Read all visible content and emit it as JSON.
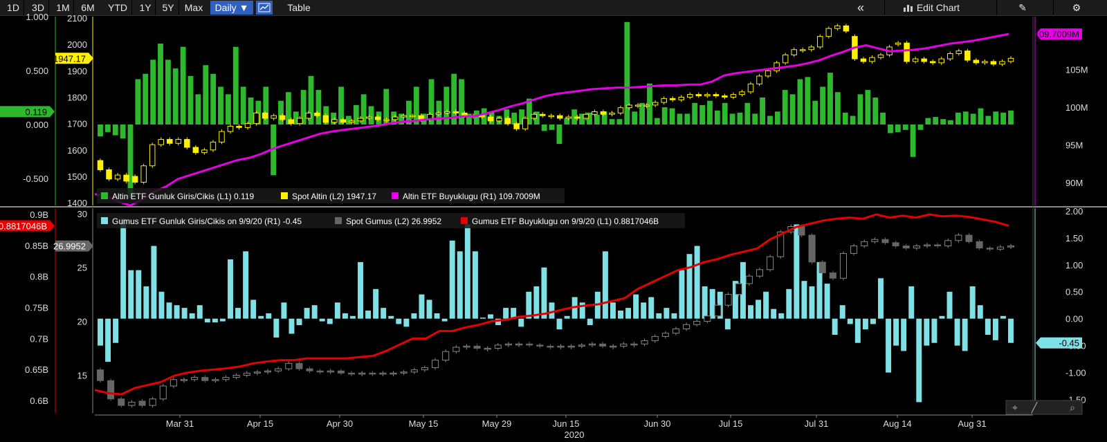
{
  "toolbar": {
    "ranges": [
      "1D",
      "3D",
      "1M",
      "6M",
      "YTD",
      "1Y",
      "5Y",
      "Max"
    ],
    "interval": "Daily",
    "table_label": "Table",
    "collapse_label": "«",
    "edit_chart_label": "Edit Chart",
    "icons": [
      "line-chart-icon",
      "pencil-icon",
      "gear-icon",
      "crosshair-icon",
      "draw-icon",
      "zoom-icon"
    ]
  },
  "colors": {
    "gold_flows": "#2db82d",
    "gold_price": "#ffef00",
    "gold_holdings": "#e600e6",
    "silver_flows": "#7fe0e6",
    "silver_price": "#666666",
    "silver_holdings": "#e60000"
  },
  "chart_data": [
    {
      "type": "bar",
      "panel": "top",
      "legend": [
        {
          "label": "Altin ETF Gunluk Giris/Cikis (L1) 0.119",
          "color": "#2db82d"
        },
        {
          "label": "Spot Altin (L2) 1947.17",
          "color": "#ffef00"
        },
        {
          "label": "Altin ETF Buyuklugu (R1) 109.7009M",
          "color": "#e600e6"
        }
      ],
      "axes": {
        "L1": {
          "ticks": [
            "1.000",
            "0.500",
            "0.000",
            "-0.500"
          ],
          "tick_values": [
            1.0,
            0.5,
            0.0,
            -0.5
          ],
          "range": [
            -0.75,
            1.0
          ],
          "marker": "0.119"
        },
        "L2": {
          "ticks": [
            "2100",
            "2000",
            "1900",
            "1800",
            "1700",
            "1600",
            "1500",
            "1400"
          ],
          "tick_values": [
            2100,
            2000,
            1900,
            1800,
            1700,
            1600,
            1500,
            1400
          ],
          "range": [
            1390,
            2105
          ],
          "marker": "1947.17"
        },
        "R1": {
          "ticks": [
            "105M",
            "100M",
            "95M",
            "90M"
          ],
          "tick_values": [
            105,
            100,
            95,
            90
          ],
          "range": [
            87,
            112
          ],
          "marker": "109.7009M"
        }
      },
      "series": [
        {
          "name": "Altin ETF Gunluk Giris/Cikis",
          "axis": "L1",
          "kind": "bar",
          "values": [
            -0.11,
            -0.07,
            -0.1,
            -0.13,
            -0.68,
            0.42,
            0.47,
            0.6,
            0.75,
            0.6,
            0.52,
            0.72,
            0.45,
            0.28,
            0.55,
            0.47,
            0.35,
            0.28,
            0.72,
            0.35,
            0.25,
            0.22,
            0.35,
            -0.47,
            0.22,
            0.3,
            0.12,
            0.32,
            0.45,
            0.32,
            0.17,
            0.11,
            0.35,
            0.08,
            0.18,
            0.28,
            0.17,
            0.12,
            0.33,
            0.12,
            0.1,
            0.22,
            0.35,
            0.1,
            0.42,
            0.22,
            0.35,
            0.47,
            0.42,
            0.1,
            0.13,
            0.15,
            0.12,
            0.08,
            0.14,
            0.11,
            0.14,
            0.24,
            0.12,
            -0.06,
            -0.05,
            -0.18,
            0.06,
            0.14,
            0.1,
            0.11,
            0.09,
            0.12,
            0.05,
            0.05,
            0.95,
            0.12,
            0.2,
            0.38,
            0.06,
            0.16,
            0.15,
            0.1,
            0.1,
            0.2,
            0.18,
            0.22,
            0.13,
            0.2,
            0.1,
            0.11,
            0.2,
            0.1,
            0.25,
            0.08,
            0.12,
            0.32,
            0.28,
            0.42,
            0.44,
            0.22,
            0.35,
            0.48,
            0.3,
            0.11,
            0.08,
            0.28,
            0.32,
            0.25,
            0.11,
            -0.08,
            -0.07,
            -0.05,
            -0.3,
            -0.05,
            0.06,
            0.07,
            0.05,
            0.04,
            0.11,
            0.12,
            0.1,
            0.15,
            0.08,
            0.12,
            0.11,
            0.13
          ]
        },
        {
          "name": "Spot Altin",
          "axis": "L2",
          "kind": "candlestick",
          "close": [
            1525,
            1490,
            1505,
            1482,
            1478,
            1540,
            1620,
            1640,
            1625,
            1640,
            1610,
            1590,
            1600,
            1630,
            1670,
            1690,
            1685,
            1700,
            1740,
            1720,
            1730,
            1715,
            1700,
            1720,
            1740,
            1730,
            1705,
            1715,
            1705,
            1710,
            1720,
            1725,
            1715,
            1715,
            1725,
            1730,
            1730,
            1715,
            1735,
            1740,
            1745,
            1740,
            1730,
            1730,
            1725,
            1710,
            1720,
            1700,
            1680,
            1720,
            1735,
            1730,
            1730,
            1720,
            1725,
            1720,
            1735,
            1745,
            1735,
            1740,
            1760,
            1770,
            1770,
            1770,
            1780,
            1795,
            1790,
            1800,
            1810,
            1805,
            1810,
            1805,
            1800,
            1810,
            1820,
            1850,
            1880,
            1900,
            1930,
            1960,
            1980,
            1980,
            1990,
            2030,
            2060,
            2070,
            2050,
            1945,
            1935,
            1950,
            1960,
            1990,
            2005,
            1935,
            1945,
            1935,
            1930,
            1945,
            1965,
            1975,
            1940,
            1930,
            1935,
            1925,
            1935,
            1947.17
          ],
          "open": [
            1560,
            1525,
            1490,
            1505,
            1500,
            1478,
            1540,
            1620,
            1640,
            1625,
            1640,
            1610,
            1590,
            1600,
            1630,
            1670,
            1690,
            1685,
            1700,
            1740,
            1720,
            1730,
            1715,
            1700,
            1720,
            1740,
            1730,
            1705,
            1715,
            1705,
            1710,
            1720,
            1725,
            1715,
            1715,
            1725,
            1730,
            1730,
            1715,
            1735,
            1740,
            1745,
            1740,
            1730,
            1730,
            1725,
            1710,
            1720,
            1700,
            1680,
            1720,
            1735,
            1730,
            1730,
            1720,
            1725,
            1720,
            1735,
            1745,
            1735,
            1740,
            1760,
            1770,
            1770,
            1770,
            1780,
            1795,
            1790,
            1800,
            1810,
            1805,
            1810,
            1805,
            1800,
            1810,
            1820,
            1850,
            1880,
            1900,
            1930,
            1960,
            1980,
            1980,
            1990,
            2030,
            2060,
            2070,
            2030,
            1945,
            1935,
            1950,
            1960,
            2000,
            2005,
            1935,
            1945,
            1935,
            1930,
            1945,
            1965,
            1975,
            1940,
            1930,
            1935,
            1925,
            1935
          ]
        },
        {
          "name": "Altin ETF Buyuklugu",
          "axis": "R1",
          "kind": "line",
          "values": [
            88.5,
            88.2,
            87.5,
            87,
            87.8,
            88.8,
            89.5,
            90.5,
            91,
            91.5,
            92,
            92.5,
            93,
            93.3,
            93.8,
            94.5,
            95,
            95.5,
            96,
            96.5,
            96.8,
            97,
            97.2,
            97.4,
            97.6,
            97.9,
            98.1,
            98.2,
            98.4,
            98.5,
            98.6,
            98.8,
            98.8,
            99.2,
            99.6,
            100.1,
            100.5,
            101,
            101.5,
            101.8,
            102,
            102.2,
            102.4,
            102.5,
            102.6,
            102.6,
            102.7,
            102.8,
            102.9,
            102.9,
            103,
            103,
            103.4,
            104.2,
            104.5,
            104.7,
            104.9,
            105.1,
            105.3,
            105.5,
            105.8,
            106.2,
            106.8,
            107.3,
            107.9,
            108.2,
            107.8,
            107.4,
            107.5,
            107.6,
            107.8,
            108.1,
            108.4,
            108.6,
            108.8,
            109.1,
            109.4,
            109.7009
          ]
        }
      ]
    },
    {
      "type": "bar",
      "panel": "bottom",
      "legend": [
        {
          "label": "Gumus ETF Gunluk Giris/Cikis on 9/9/20 (R1) -0.45",
          "color": "#7fe0e6"
        },
        {
          "label": "Spot Gumus (L2) 26.9952",
          "color": "#666666"
        },
        {
          "label": "Gumus ETF Buyuklugu on 9/9/20 (L1) 0.8817046B",
          "color": "#e60000"
        }
      ],
      "axes": {
        "L1": {
          "ticks": [
            "0.9B",
            "0.85B",
            "0.8B",
            "0.75B",
            "0.7B",
            "0.65B",
            "0.6B"
          ],
          "tick_values": [
            0.9,
            0.85,
            0.8,
            0.75,
            0.7,
            0.65,
            0.6
          ],
          "range": [
            0.58,
            0.91
          ],
          "marker": "0.8817046B"
        },
        "L2": {
          "ticks": [
            "30",
            "25",
            "20",
            "15"
          ],
          "tick_values": [
            30,
            25,
            20,
            15
          ],
          "range": [
            11.5,
            30.5
          ],
          "marker": "26.9952"
        },
        "R1": {
          "ticks": [
            "2.00",
            "1.50",
            "1.00",
            "0.50",
            "0.00",
            "-0.50",
            "-1.00",
            "-1.50"
          ],
          "tick_values": [
            2.0,
            1.5,
            1.0,
            0.5,
            0.0,
            -0.5,
            -1.0,
            -1.5
          ],
          "range": [
            -1.75,
            2.05
          ],
          "marker": "-0.45"
        }
      },
      "series": [
        {
          "name": "Gumus ETF Gunluk Giris/Cikis",
          "axis": "R1",
          "kind": "bar",
          "values": [
            -0.5,
            -0.8,
            -0.45,
            1.85,
            0.9,
            0.9,
            0.6,
            1.35,
            0.5,
            0.3,
            0.25,
            0.2,
            0.1,
            0.25,
            -0.07,
            -0.07,
            -0.05,
            1.1,
            0.2,
            1.25,
            0.35,
            0.05,
            0.1,
            -0.35,
            0.3,
            -0.28,
            -0.12,
            0.2,
            0.25,
            -0.05,
            -0.1,
            0.3,
            0.1,
            0.05,
            1.05,
            0.15,
            0.55,
            0.2,
            0.05,
            -0.1,
            -0.15,
            0.1,
            0.45,
            0.35,
            0.1,
            -0.05,
            1.45,
            1.25,
            1.75,
            1.25,
            0.02,
            0.08,
            -0.12,
            0.2,
            0.2,
            -0.15,
            0.5,
            0.6,
            0.95,
            0.3,
            -0.2,
            0.05,
            0.4,
            0.3,
            -0.12,
            0.5,
            1.25,
            0.3,
            0.15,
            0.2,
            0.45,
            0.3,
            0.4,
            0.1,
            0.2,
            0.1,
            0.9,
            1.2,
            1.35,
            0.6,
            0.55,
            0.5,
            -0.2,
            0.7,
            1.05,
            0.25,
            0.35,
            0.5,
            0.18,
            0.1,
            0.55,
            1.75,
            0.7,
            0.6,
            1.05,
            0.65,
            -0.3,
            0.25,
            -0.1,
            -0.45,
            -0.2,
            -0.1,
            0.75,
            -1.0,
            -0.5,
            -0.6,
            0.6,
            -1.55,
            -0.5,
            -0.45,
            0.05,
            0.5,
            -0.5,
            -0.6,
            0.6,
            0.25,
            -0.3,
            -0.4,
            0.05,
            -0.45
          ]
        },
        {
          "name": "Spot Gumus",
          "axis": "L2",
          "kind": "candlestick",
          "close": [
            14.5,
            12.8,
            12.2,
            12.5,
            12.2,
            12.8,
            14,
            14.6,
            14.6,
            14.8,
            14.5,
            14.6,
            14.8,
            15,
            15.2,
            15.3,
            15.4,
            15.6,
            16.1,
            15.6,
            15.4,
            15.3,
            15.4,
            15.2,
            15.1,
            15.2,
            15.1,
            15.2,
            15.2,
            15.3,
            15.5,
            15.7,
            16.4,
            17.2,
            17.6,
            17.7,
            17.5,
            17.5,
            17.8,
            17.9,
            17.9,
            17.8,
            17.7,
            17.6,
            17.7,
            17.7,
            17.8,
            17.9,
            17.7,
            17.7,
            17.9,
            17.9,
            18.2,
            18.6,
            18.9,
            19.3,
            19.7,
            20,
            20.5,
            21.5,
            22.5,
            23.5,
            24.2,
            24.8,
            26,
            28.3,
            28.8,
            28,
            25.5,
            24.5,
            24,
            26.3,
            27,
            27.4,
            27.6,
            27.3,
            27,
            26.8,
            27,
            27.1,
            27,
            27.5,
            28,
            27.4,
            26.8,
            26.7,
            26.9,
            26.9952
          ],
          "open": [
            15.5,
            14.5,
            12.8,
            12.2,
            12.6,
            12.2,
            12.8,
            14,
            14.6,
            14.6,
            14.8,
            14.5,
            14.6,
            14.8,
            15,
            15.2,
            15.3,
            15.4,
            15.6,
            16.1,
            15.6,
            15.4,
            15.3,
            15.4,
            15.2,
            15.1,
            15.2,
            15.1,
            15.2,
            15.2,
            15.3,
            15.5,
            15.7,
            16.4,
            17.2,
            17.6,
            17.7,
            17.5,
            17.5,
            17.8,
            17.9,
            17.9,
            17.8,
            17.7,
            17.6,
            17.7,
            17.7,
            17.8,
            17.9,
            17.7,
            17.7,
            17.9,
            17.9,
            18.2,
            18.6,
            18.9,
            19.3,
            19.7,
            20,
            20.5,
            21.5,
            22.5,
            23.5,
            24.2,
            24.8,
            26,
            28.3,
            28.8,
            28,
            25.5,
            24.5,
            24,
            26.3,
            27,
            27.4,
            27.6,
            27.3,
            27,
            26.8,
            27,
            27.1,
            27,
            27.5,
            28,
            27.4,
            26.8,
            26.7,
            26.9
          ]
        },
        {
          "name": "Gumus ETF Buyuklugu",
          "axis": "L1",
          "kind": "line",
          "values": [
            0.617,
            0.612,
            0.61,
            0.62,
            0.625,
            0.63,
            0.64,
            0.645,
            0.648,
            0.65,
            0.652,
            0.655,
            0.66,
            0.663,
            0.665,
            0.665,
            0.668,
            0.668,
            0.668,
            0.668,
            0.67,
            0.672,
            0.68,
            0.69,
            0.7,
            0.7,
            0.712,
            0.712,
            0.718,
            0.722,
            0.728,
            0.73,
            0.735,
            0.737,
            0.74,
            0.745,
            0.75,
            0.753,
            0.755,
            0.76,
            0.765,
            0.78,
            0.79,
            0.8,
            0.81,
            0.815,
            0.823,
            0.828,
            0.835,
            0.84,
            0.845,
            0.86,
            0.87,
            0.88,
            0.885,
            0.89,
            0.893,
            0.895,
            0.893,
            0.9,
            0.895,
            0.898,
            0.895,
            0.9,
            0.897,
            0.898,
            0.896,
            0.892,
            0.888,
            0.8817046
          ]
        }
      ]
    }
  ],
  "x_axis": {
    "ticks": [
      "Mar 31",
      "Apr 15",
      "Apr 30",
      "May 15",
      "May 29",
      "Jun 15",
      "Jun 30",
      "Jul 15",
      "Jul 31",
      "Aug 14",
      "Aug 31"
    ],
    "year": "2020"
  }
}
